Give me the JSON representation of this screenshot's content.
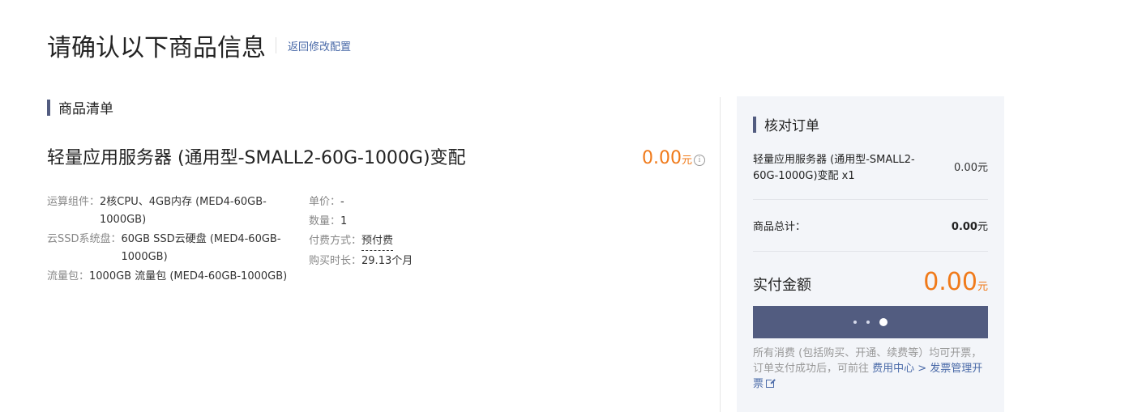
{
  "header": {
    "title": "请确认以下商品信息",
    "back_link": "返回修改配置"
  },
  "product_list": {
    "section_title": "商品清单",
    "product": {
      "name": "轻量应用服务器 (通用型-SMALL2-60G-1000G)变配",
      "price": "0.00",
      "unit": "元",
      "info_icon": "info-icon"
    },
    "specs_left": [
      {
        "key": "运算组件：",
        "value": "2核CPU、4GB内存 (MED4-60GB-1000GB)"
      },
      {
        "key": "云SSD系统盘：",
        "value": "60GB SSD云硬盘 (MED4-60GB-1000GB)"
      },
      {
        "key": "流量包：",
        "value": "1000GB 流量包 (MED4-60GB-1000GB)"
      }
    ],
    "specs_right": [
      {
        "key": "单价：",
        "value": "-"
      },
      {
        "key": "数量：",
        "value": "1"
      },
      {
        "key": "付费方式：",
        "value": "预付费"
      },
      {
        "key": "购买时长：",
        "value": "29.13个月"
      }
    ]
  },
  "order_summary": {
    "section_title": "核对订单",
    "line_item": {
      "name": "轻量应用服务器 (通用型-SMALL2-60G-1000G)变配 x1",
      "value": "0.00",
      "unit": "元"
    },
    "total": {
      "label": "商品总计：",
      "value": "0.00",
      "unit": "元"
    },
    "payment": {
      "label": "实付金额",
      "value": "0.00",
      "unit": "元"
    },
    "pay_button_state": "loading",
    "note_text": "所有消费 (包括购买、开通、续费等）均可开票，订单支付成功后，可前往 ",
    "note_link": "费用中心 > 发票管理开票",
    "note_link_icon": "external-link-icon"
  },
  "colors": {
    "accent_orange": "#f07a1a",
    "brand_slate": "#525c80",
    "link_blue": "#4a6aa8",
    "panel_bg": "#f3f5f9"
  }
}
